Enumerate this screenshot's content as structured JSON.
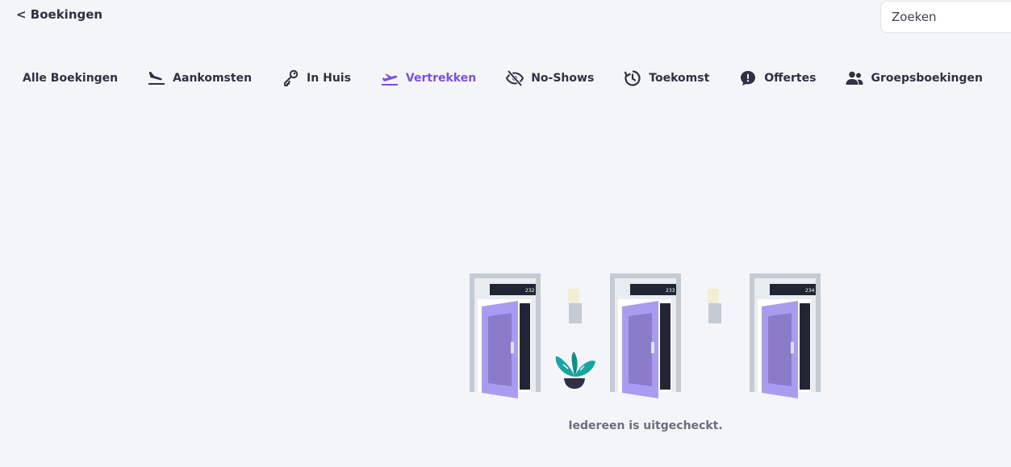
{
  "header": {
    "back_label": "< Boekingen",
    "search_placeholder": "Zoeken"
  },
  "tabs": [
    {
      "label": "Alle Boekingen",
      "icon": "none",
      "active": false
    },
    {
      "label": "Aankomsten",
      "icon": "plane-landing-icon",
      "active": false
    },
    {
      "label": "In Huis",
      "icon": "keys-icon",
      "active": false
    },
    {
      "label": "Vertrekken",
      "icon": "plane-departure-icon",
      "active": true
    },
    {
      "label": "No-Shows",
      "icon": "eye-off-icon",
      "active": false
    },
    {
      "label": "Toekomst",
      "icon": "clock-forward-icon",
      "active": false
    },
    {
      "label": "Offertes",
      "icon": "speech-alert-icon",
      "active": false
    },
    {
      "label": "Groepsboekingen",
      "icon": "users-icon",
      "active": false
    }
  ],
  "illustration": {
    "room_numbers": [
      "232",
      "233",
      "234"
    ]
  },
  "empty_state": {
    "message": "Iedereen is uitgecheckt."
  },
  "colors": {
    "accent": "#7a4fe0",
    "background": "#f4f5f8",
    "door": "#a99cf0",
    "plant": "#17a5a0"
  }
}
